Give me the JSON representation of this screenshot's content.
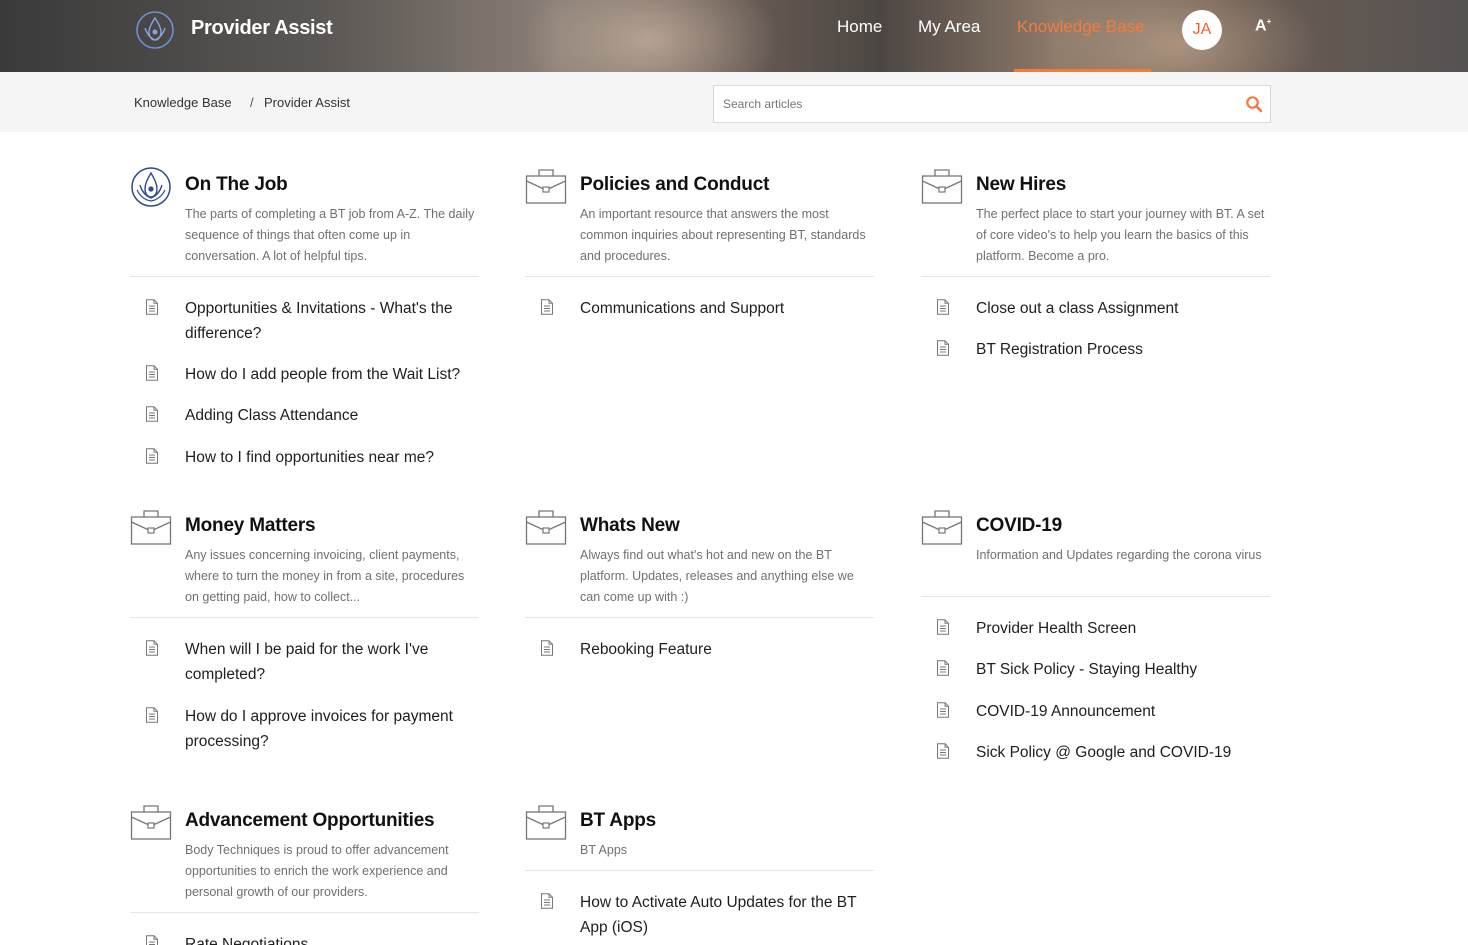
{
  "header": {
    "brand": "Provider Assist",
    "nav": [
      {
        "label": "Home"
      },
      {
        "label": "My Area"
      },
      {
        "label": "Knowledge Base",
        "active": true
      }
    ],
    "avatar_initials": "JA",
    "accessibility_label": "A",
    "accent_color": "#f47b3d"
  },
  "breadcrumb": {
    "items": [
      "Knowledge Base",
      "Provider Assist"
    ],
    "separator": "/"
  },
  "search": {
    "placeholder": "Search articles",
    "value": ""
  },
  "categories": [
    {
      "icon": "brand-logo-icon",
      "title": "On The Job",
      "description": "The parts of completing a BT job from A-Z. The daily sequence of things that often come up in conversation. A lot of helpful tips.",
      "articles": [
        "Opportunities & Invitations - What's the difference?",
        "How do I add people from the Wait List?",
        "Adding Class Attendance",
        "How to I find opportunities near me?"
      ]
    },
    {
      "icon": "briefcase-icon",
      "title": "Policies and Conduct",
      "description": "An important resource that answers the most common inquiries about representing BT, standards and procedures.",
      "articles": [
        "Communications and Support"
      ]
    },
    {
      "icon": "briefcase-icon",
      "title": "New Hires",
      "description": "The perfect place to start your journey with BT. A set of core video's to help you learn the basics of this platform. Become a pro.",
      "articles": [
        "Close out a class Assignment",
        "BT Registration Process"
      ]
    },
    {
      "icon": "briefcase-icon",
      "title": "Money Matters",
      "description": "Any issues concerning invoicing, client payments, where to turn the money in from a site, procedures on getting paid, how to collect...",
      "articles": [
        "When will I be paid for the work I've completed?",
        "How do I approve invoices for payment processing?"
      ]
    },
    {
      "icon": "briefcase-icon",
      "title": "Whats New",
      "description": "Always find out what's hot and new on the BT platform. Updates, releases and anything else we can come up with :)",
      "articles": [
        "Rebooking Feature"
      ]
    },
    {
      "icon": "briefcase-icon",
      "title": "COVID-19",
      "description": "Information and Updates regarding the corona virus",
      "articles": [
        "Provider Health Screen",
        "BT Sick Policy - Staying Healthy",
        "COVID-19 Announcement",
        "Sick Policy @ Google and COVID-19"
      ]
    },
    {
      "icon": "briefcase-icon",
      "title": "Advancement Opportunities",
      "description": "Body Techniques is proud to offer advancement opportunities to enrich the work experience and personal growth of our providers.",
      "articles": [
        "Rate Negotiations"
      ]
    },
    {
      "icon": "briefcase-icon",
      "title": "BT Apps",
      "description": "BT Apps",
      "articles": [
        "How to Activate Auto Updates for the BT App (iOS)"
      ]
    }
  ]
}
